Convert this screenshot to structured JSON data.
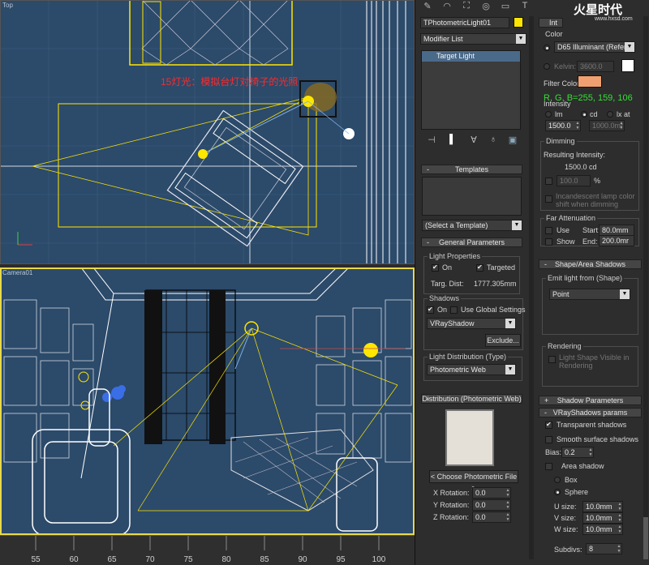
{
  "viewports": {
    "top_label": "Top",
    "camera_label": "Camera01",
    "annotation": "15灯光：模拟台灯对椅子的光照"
  },
  "timeline": {
    "ticks": [
      "55",
      "60",
      "65",
      "70",
      "75",
      "80",
      "85",
      "90",
      "95",
      "100"
    ]
  },
  "watermark": {
    "brand": "火星时代",
    "url": "www.hxsd.com"
  },
  "left_col": {
    "object_name": "TPhotometricLight01",
    "object_color": "#ffe600",
    "modifier_list": "Modifier List",
    "stack_item": "Target Light",
    "templates": {
      "title": "Templates",
      "select": "(Select a Template)"
    },
    "general": {
      "title": "General Parameters",
      "light_properties": "Light Properties",
      "on": "On",
      "targeted": "Targeted",
      "targ_dist_label": "Targ. Dist:",
      "targ_dist_value": "1777.305mm",
      "shadows_title": "Shadows",
      "shadows_on": "On",
      "use_global": "Use Global Settings",
      "shadow_type": "VRayShadow",
      "exclude": "Exclude...",
      "distribution_title": "Light Distribution (Type)",
      "distribution_value": "Photometric Web"
    },
    "distribution": {
      "title": "Distribution (Photometric Web)",
      "choose_file": "< Choose Photometric File >",
      "x_rot_label": "X Rotation:",
      "x_rot": "0.0",
      "y_rot_label": "Y Rotation:",
      "y_rot": "0.0",
      "z_rot_label": "Z Rotation:",
      "z_rot": "0.0"
    }
  },
  "right_col": {
    "intensity_header": "Int",
    "color_group": "Color",
    "illuminant": "D65 Illuminant (Refere",
    "kelvin_label": "Kelvin:",
    "kelvin_value": "3600.0",
    "filter_color_label": "Filter Color:",
    "filter_color": "#f0a070",
    "rgb_readout": "R, G, B=255, 159, 106",
    "intensity_label": "Intensity",
    "lm": "lm",
    "cd": "cd",
    "lx_at": "lx at",
    "intensity_value": "1500.0",
    "lx_distance": "1000.0mr",
    "dimming_title": "Dimming",
    "resulting_label": "Resulting Intensity:",
    "resulting_value": "1500.0 cd",
    "dim_percent": "100.0",
    "percent_sign": "%",
    "incandescent_1": "Incandescent lamp color",
    "incandescent_2": "shift when dimming",
    "far_atten_title": "Far Attenuation",
    "use": "Use",
    "start_label": "Start:",
    "start_value": "80.0mm",
    "show": "Show",
    "end_label": "End:",
    "end_value": "200.0mr",
    "shape_title": "Shape/Area Shadows",
    "emit_label": "Emit light from (Shape)",
    "emit_value": "Point",
    "rendering_title": "Rendering",
    "shape_visible_1": "Light Shape Visible in",
    "shape_visible_2": "Rendering",
    "shadow_params_title": "Shadow Parameters",
    "vray_title": "VRayShadows params",
    "transparent": "Transparent shadows",
    "smooth": "Smooth surface shadows",
    "bias_label": "Bias:",
    "bias_value": "0.2",
    "area_shadow": "Area shadow",
    "box": "Box",
    "sphere": "Sphere",
    "u_label": "U size:",
    "u_value": "10.0mm",
    "v_label": "V size:",
    "v_value": "10.0mm",
    "w_label": "W size:",
    "w_value": "10.0mm",
    "subdivs_label": "Subdivs:",
    "subdivs_value": "8"
  }
}
